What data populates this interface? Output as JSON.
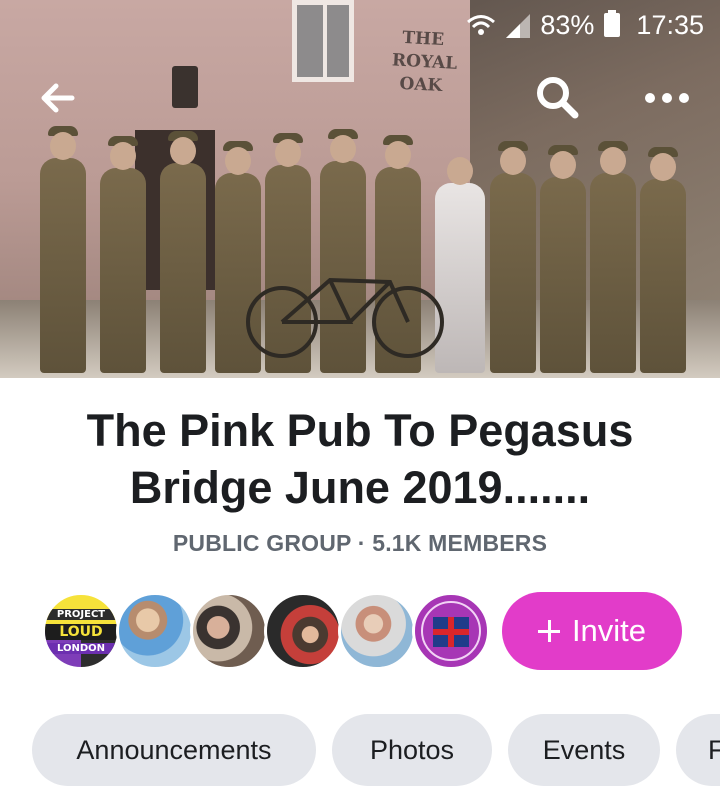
{
  "status_bar": {
    "battery_percent": "83%",
    "time": "17:35"
  },
  "cover": {
    "sign_line1": "THE",
    "sign_line2": "ROYAL",
    "sign_line3": "OAK"
  },
  "group": {
    "title": "The Pink Pub To Pegasus Bridge June 2019.......",
    "meta": "PUBLIC GROUP · 5.1K MEMBERS"
  },
  "members": {
    "avatar1_line1": "PROJECT",
    "avatar1_line2": "LOUD",
    "avatar1_line3": "LONDON"
  },
  "actions": {
    "invite_label": "Invite"
  },
  "tabs": [
    {
      "label": "Announcements"
    },
    {
      "label": "Photos"
    },
    {
      "label": "Events"
    },
    {
      "label": "F"
    }
  ],
  "colors": {
    "invite_background": "#e23cc9",
    "chip_background": "#e4e6eb",
    "title_text": "#1c1e21",
    "meta_text": "#606770"
  },
  "icons": {
    "back": "back-arrow-icon",
    "search": "search-icon",
    "more": "more-options-icon",
    "wifi": "wifi-icon",
    "signal": "cell-signal-icon",
    "battery": "battery-icon",
    "plus": "plus-icon"
  }
}
